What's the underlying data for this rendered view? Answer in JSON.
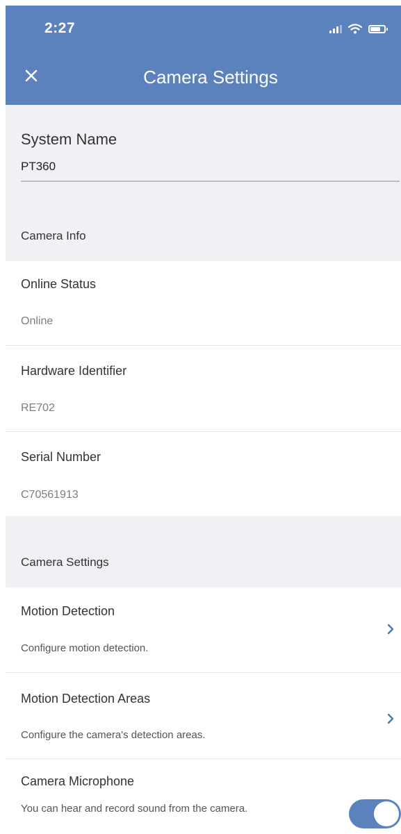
{
  "status_bar": {
    "time": "2:27"
  },
  "header": {
    "title": "Camera Settings",
    "close_icon": "close-icon"
  },
  "system_name": {
    "label": "System Name",
    "value": "PT360"
  },
  "camera_info": {
    "section_title": "Camera Info",
    "rows": [
      {
        "title": "Online Status",
        "value": "Online"
      },
      {
        "title": "Hardware Identifier",
        "value": "RE702"
      },
      {
        "title": "Serial Number",
        "value": "C70561913"
      }
    ]
  },
  "camera_settings": {
    "section_title": "Camera Settings",
    "rows": [
      {
        "title": "Motion Detection",
        "subtitle": "Configure motion detection.",
        "control": "chevron-right-icon"
      },
      {
        "title": "Motion Detection Areas",
        "subtitle": "Configure the camera's detection areas.",
        "control": "chevron-right-icon"
      },
      {
        "title": "Camera Microphone",
        "subtitle": "You can hear and record sound from the camera.",
        "control": "toggle",
        "enabled": true
      }
    ]
  },
  "colors": {
    "accent": "#5b82bc",
    "background": "#f0f1f5",
    "card": "#ffffff"
  }
}
